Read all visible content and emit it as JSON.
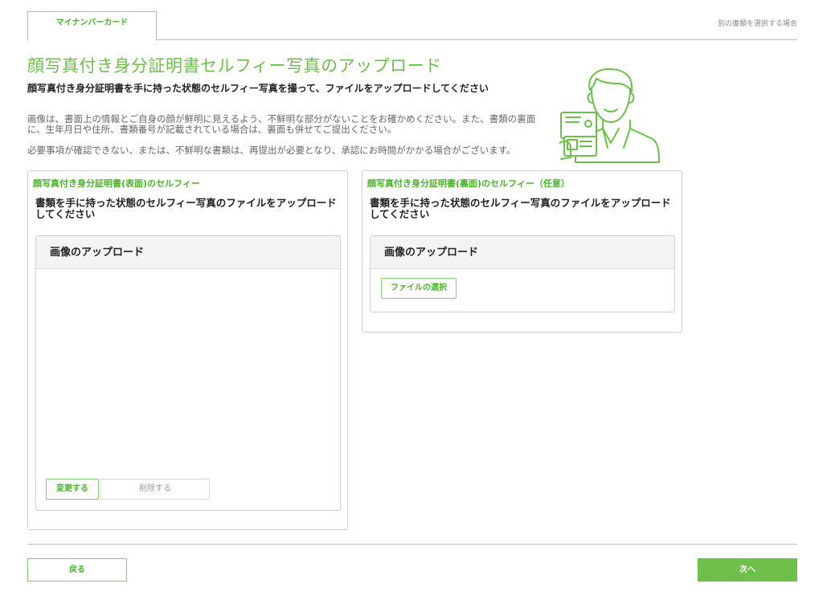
{
  "tabs": {
    "active_label": "マイナンバーカード",
    "alt_link": "別の書類を選択する場合"
  },
  "header": {
    "title": "顔写真付き身分証明書セルフィー写真のアップロード",
    "subtitle": "顔写真付き身分証明書を手に持った状態のセルフィー写真を撮って、ファイルをアップロードしてください",
    "description1": "画像は、書面上の情報とご自身の顔が鮮明に見えるよう、不鮮明な部分がないことをお確かめください。また、書類の裏面に、生年月日や住所、書類番号が記載されている場合は、裏面も併せてご提出ください。",
    "description2": "必要事項が確認できない、または、不鮮明な書類は、再提出が必要となり、承認にお時間がかかる場合がございます。"
  },
  "illustration": {
    "icon": "person-holding-id-icon"
  },
  "cards": {
    "front": {
      "heading": "顔写真付き身分証明書(表面)のセルフィー",
      "instruction": "書類を手に持った状態のセルフィー写真のファイルをアップロードしてください",
      "upload_title": "画像のアップロード",
      "change_label": "変更する",
      "delete_label": "削除する"
    },
    "back": {
      "heading": "顔写真付き身分証明書(裏面)のセルフィー（任意）",
      "instruction": "書類を手に持った状態のセルフィー写真のファイルをアップロードしてください",
      "upload_title": "画像のアップロード",
      "select_label": "ファイルの選択"
    }
  },
  "footer": {
    "back_label": "戻る",
    "next_label": "次へ"
  },
  "colors": {
    "accent": "#6cc04a",
    "accent_dark": "#4cb32a"
  }
}
